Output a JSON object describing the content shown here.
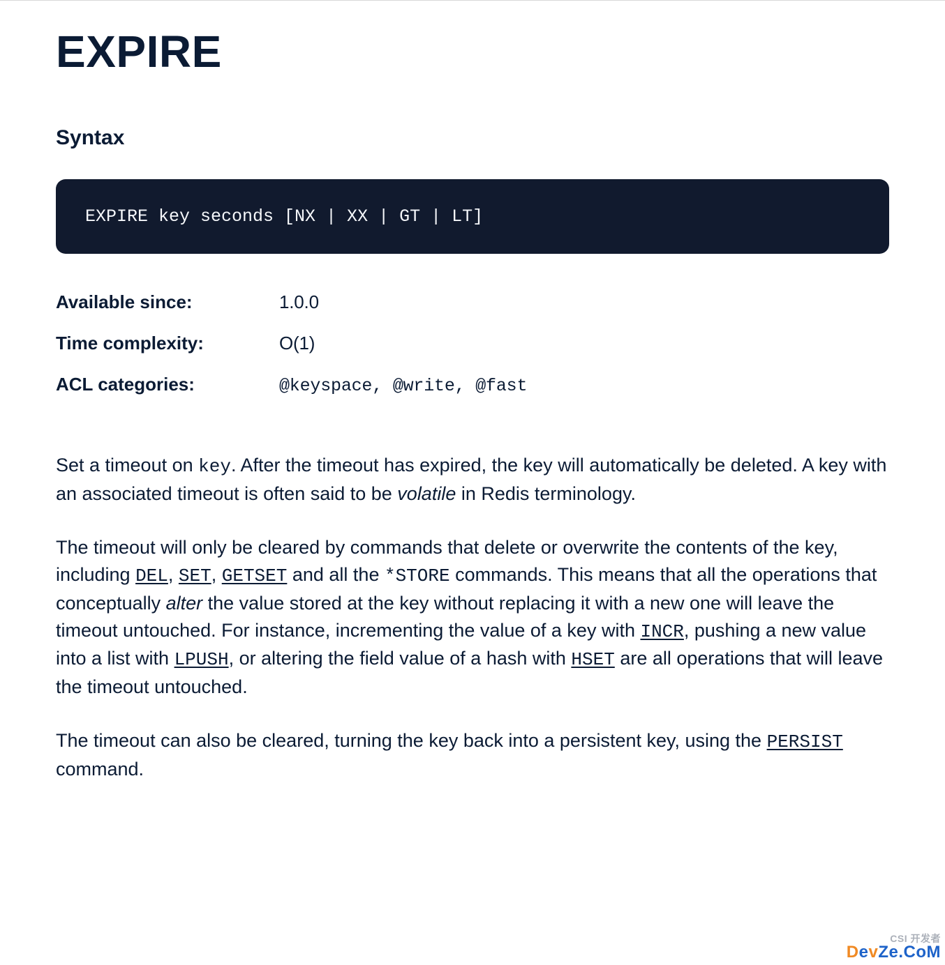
{
  "command": {
    "title": "EXPIRE",
    "syntax_heading": "Syntax",
    "syntax_code": "EXPIRE key seconds [NX | XX | GT | LT]"
  },
  "meta": {
    "available_since_label": "Available since:",
    "available_since_value": "1.0.0",
    "time_complexity_label": "Time complexity:",
    "time_complexity_value": "O(1)",
    "acl_categories_label": "ACL categories:",
    "acl_categories_value": "@keyspace, @write, @fast"
  },
  "body": {
    "p1_a": "Set a timeout on ",
    "p1_key": "key",
    "p1_b": ". After the timeout has expired, the key will automatically be deleted. A key with an associated timeout is often said to be ",
    "p1_volatile": "volatile",
    "p1_c": " in Redis terminology.",
    "p2_a": "The timeout will only be cleared by commands that delete or overwrite the contents of the key, including ",
    "p2_del": "DEL",
    "p2_comma1": ", ",
    "p2_set": "SET",
    "p2_comma2": ", ",
    "p2_getset": "GETSET",
    "p2_b": " and all the ",
    "p2_store": "*STORE",
    "p2_c": " commands. This means that all the operations that conceptually ",
    "p2_alter": "alter",
    "p2_d": " the value stored at the key without replacing it with a new one will leave the timeout untouched. For instance, incrementing the value of a key with ",
    "p2_incr": "INCR",
    "p2_e": ", pushing a new value into a list with ",
    "p2_lpush": "LPUSH",
    "p2_f": ", or altering the field value of a hash with ",
    "p2_hset": "HSET",
    "p2_g": " are all operations that will leave the timeout untouched.",
    "p3_a": "The timeout can also be cleared, turning the key back into a persistent key, using the ",
    "p3_persist": "PERSIST",
    "p3_b": " command."
  },
  "watermark": {
    "line1": "CSI 开发者",
    "line2_a": "D",
    "line2_b": "e",
    "line2_c": "v",
    "line2_d": "Z",
    "line2_e": "e.CoM"
  }
}
